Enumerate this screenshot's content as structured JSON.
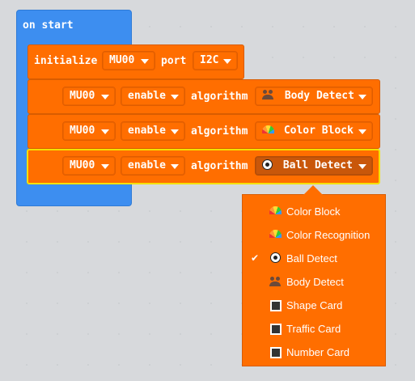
{
  "on_start": "on start",
  "init": {
    "label": "initialize",
    "device": "MU00",
    "port_label": "port",
    "port": "I2C"
  },
  "rows": [
    {
      "device": "MU00",
      "action": "enable",
      "algo_label": "algorithm",
      "algo": "Body Detect",
      "icon": "people-icon"
    },
    {
      "device": "MU00",
      "action": "enable",
      "algo_label": "algorithm",
      "algo": "Color Block",
      "icon": "rainbow-icon"
    },
    {
      "device": "MU00",
      "action": "enable",
      "algo_label": "algorithm",
      "algo": "Ball Detect",
      "icon": "ball-icon"
    }
  ],
  "menu": {
    "selected": "Ball Detect",
    "items": [
      {
        "label": "Color Block",
        "icon": "rainbow-icon"
      },
      {
        "label": "Color Recognition",
        "icon": "rainbow-icon"
      },
      {
        "label": "Ball Detect",
        "icon": "ball-icon",
        "checked": "✔"
      },
      {
        "label": "Body Detect",
        "icon": "people-icon"
      },
      {
        "label": "Shape Card",
        "icon": "square-icon"
      },
      {
        "label": "Traffic Card",
        "icon": "square-icon"
      },
      {
        "label": "Number Card",
        "icon": "square-icon"
      }
    ]
  },
  "colors": {
    "event": "#3d8ef0",
    "block": "#ff6e00",
    "selection": "#f5e100"
  }
}
